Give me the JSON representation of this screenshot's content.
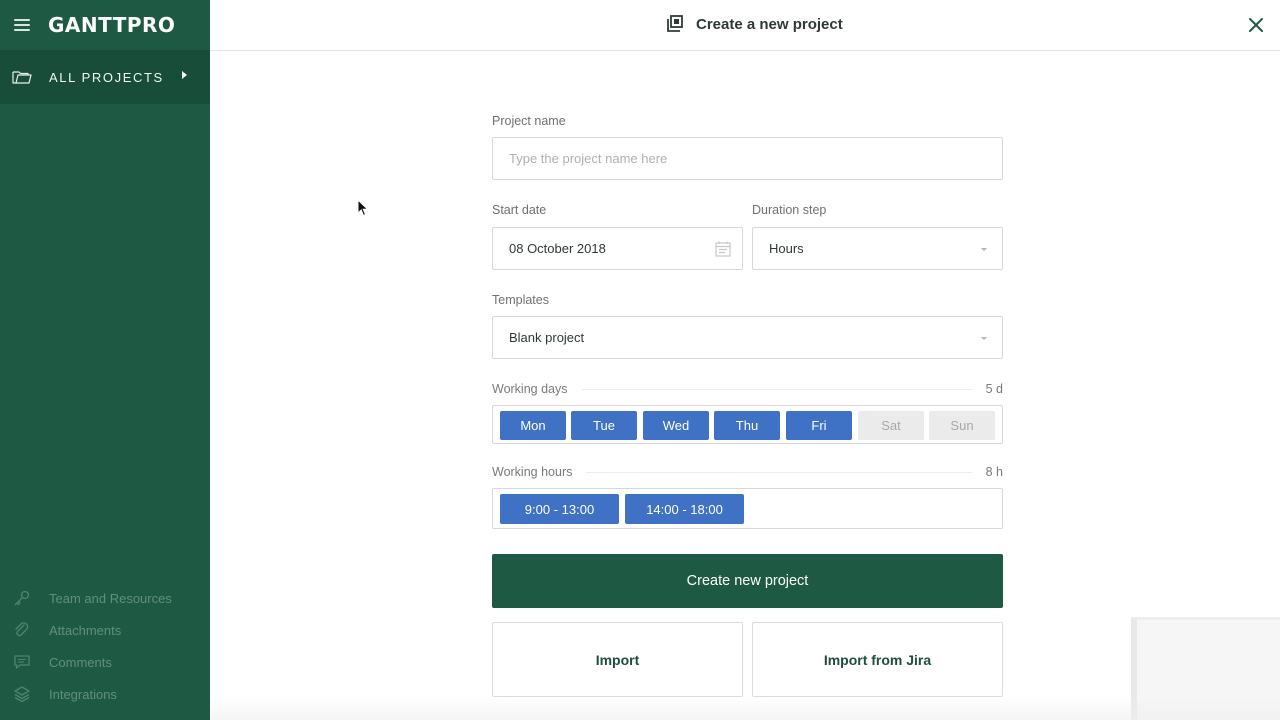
{
  "app": {
    "logo": "GANTTPRO",
    "brand_color": "#1e5a43",
    "accent_color": "#3f72c5"
  },
  "sidebar": {
    "all_projects_label": "ALL PROJECTS",
    "bottom_links": [
      {
        "label": "Team and Resources",
        "icon": "key-icon"
      },
      {
        "label": "Attachments",
        "icon": "paperclip-icon"
      },
      {
        "label": "Comments",
        "icon": "comment-icon"
      },
      {
        "label": "Integrations",
        "icon": "layers-icon"
      }
    ]
  },
  "header": {
    "title": "Create a new project"
  },
  "form": {
    "project_name": {
      "label": "Project name",
      "placeholder": "Type the project name here",
      "value": ""
    },
    "start_date": {
      "label": "Start date",
      "value": "08 October 2018"
    },
    "duration_step": {
      "label": "Duration step",
      "value": "Hours"
    },
    "templates": {
      "label": "Templates",
      "value": "Blank project"
    },
    "working_days": {
      "label": "Working days",
      "total": "5 d",
      "days": [
        {
          "label": "Mon",
          "active": true
        },
        {
          "label": "Tue",
          "active": true
        },
        {
          "label": "Wed",
          "active": true
        },
        {
          "label": "Thu",
          "active": true
        },
        {
          "label": "Fri",
          "active": true
        },
        {
          "label": "Sat",
          "active": false
        },
        {
          "label": "Sun",
          "active": false
        }
      ]
    },
    "working_hours": {
      "label": "Working hours",
      "total": "8 h",
      "ranges": [
        "9:00 - 13:00",
        "14:00 - 18:00"
      ]
    },
    "create_button": "Create new project",
    "import_button": "Import",
    "import_jira_button": "Import from Jira"
  }
}
